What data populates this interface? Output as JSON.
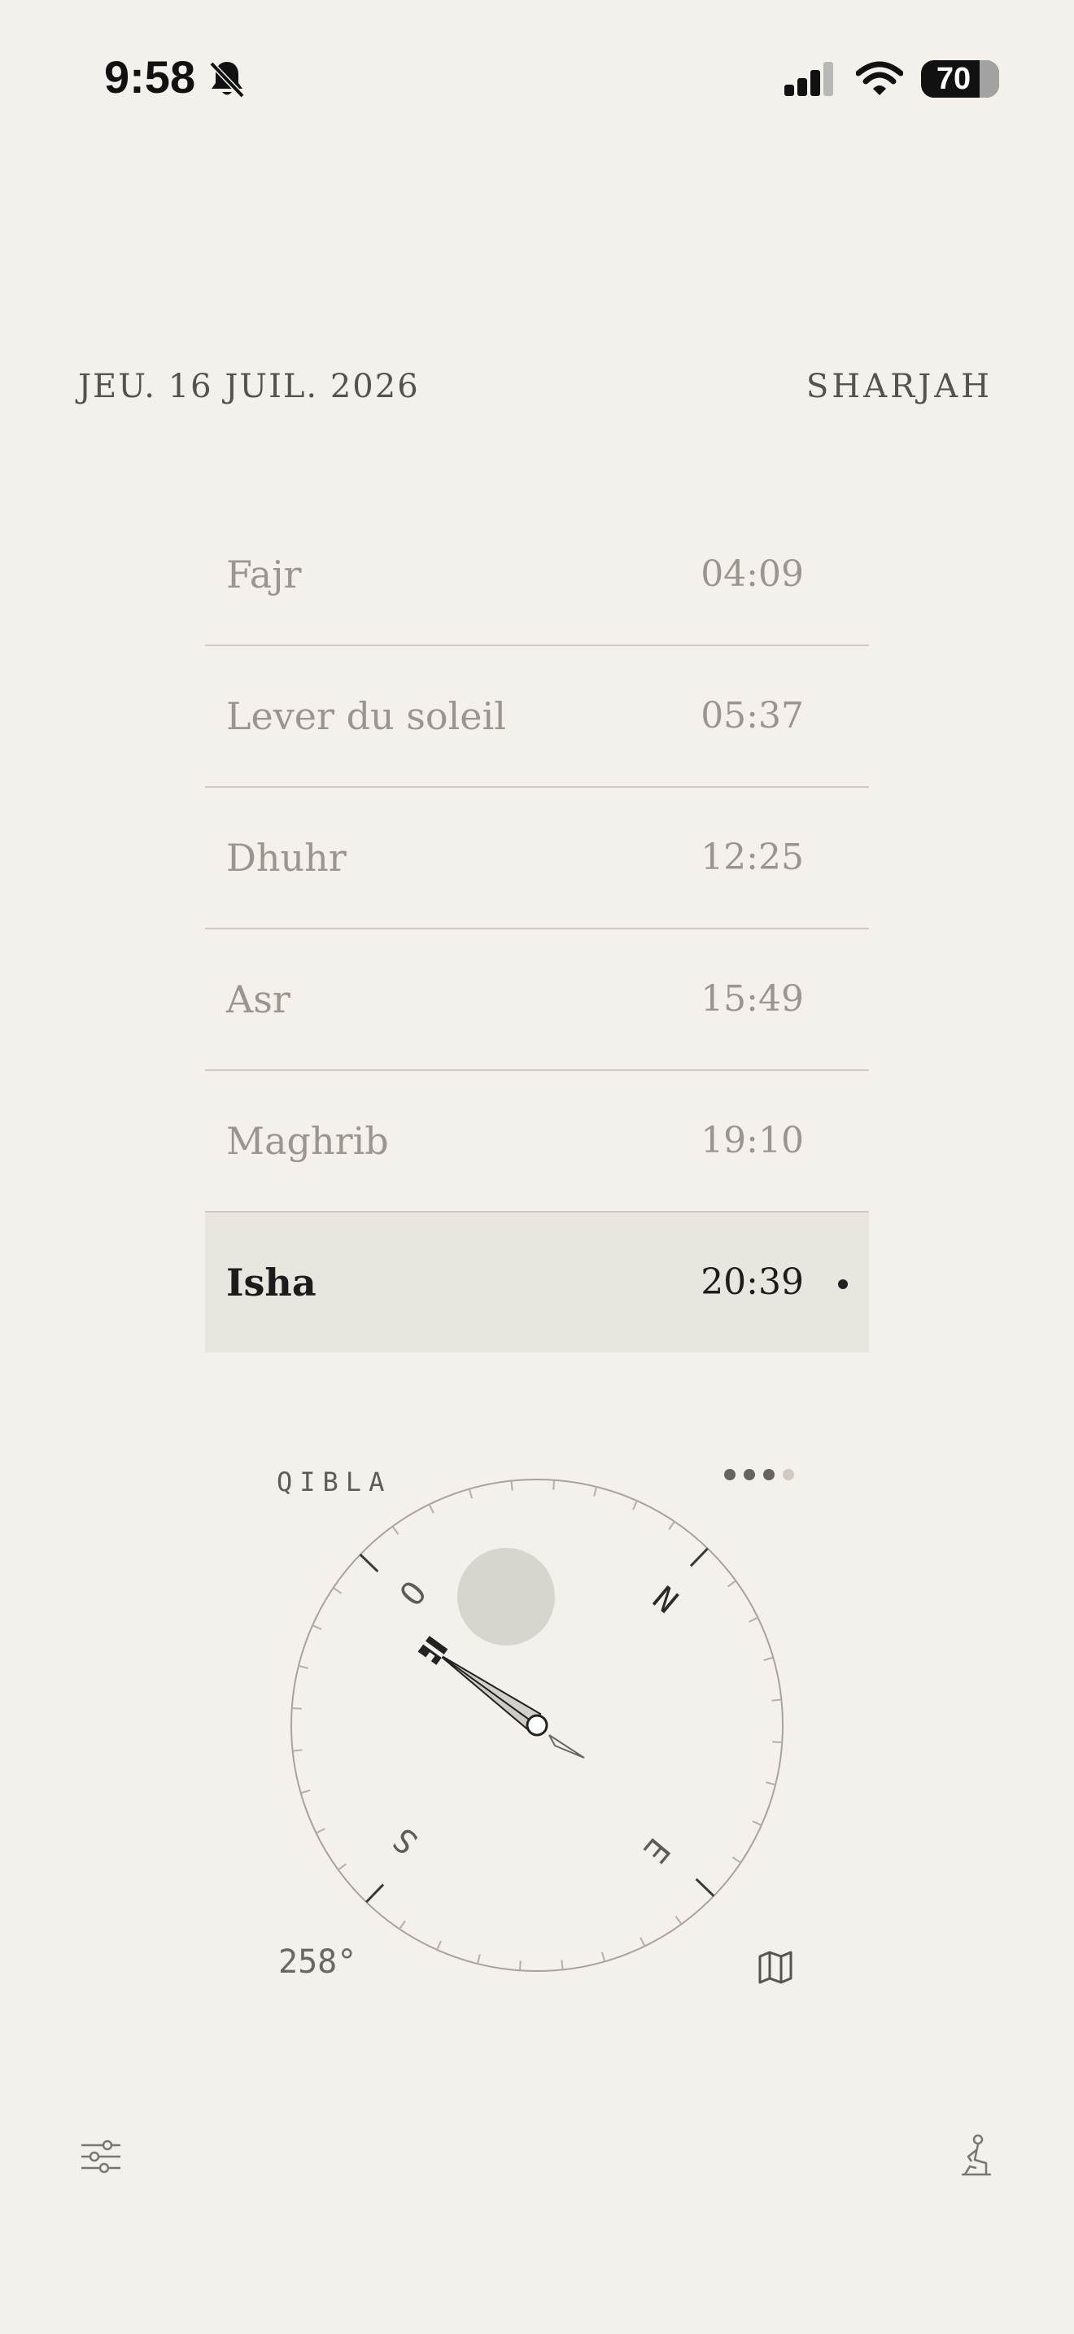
{
  "status_bar": {
    "time": "9:58",
    "battery": "70",
    "icons": [
      "bell-slash-icon",
      "signal-icon",
      "wifi-icon",
      "battery-icon"
    ]
  },
  "header": {
    "date": "JEU. 16 JUIL. 2026",
    "city": "SHARJAH"
  },
  "prayers": [
    {
      "name": "Fajr",
      "time": "04:09"
    },
    {
      "name": "Lever du soleil",
      "time": "05:37"
    },
    {
      "name": "Dhuhr",
      "time": "12:25"
    },
    {
      "name": "Asr",
      "time": "15:49"
    },
    {
      "name": "Maghrib",
      "time": "19:10"
    },
    {
      "name": "Isha",
      "time": "20:39",
      "current": true
    }
  ],
  "qibla": {
    "label": "QIBLA",
    "heading": "258°",
    "cardinals": {
      "north": "N",
      "east": "E",
      "south": "S",
      "west": "O"
    },
    "page_indicator": {
      "count": 4,
      "active": 3
    }
  },
  "colors": {
    "background": "#f4f1ec",
    "highlight_row": "#e9e6e0",
    "muted_text": "#9a958e",
    "primary_text": "#1c1c1c"
  },
  "bottom_bar": {
    "icons": [
      "settings-sliders-icon",
      "prayer-person-icon"
    ]
  }
}
